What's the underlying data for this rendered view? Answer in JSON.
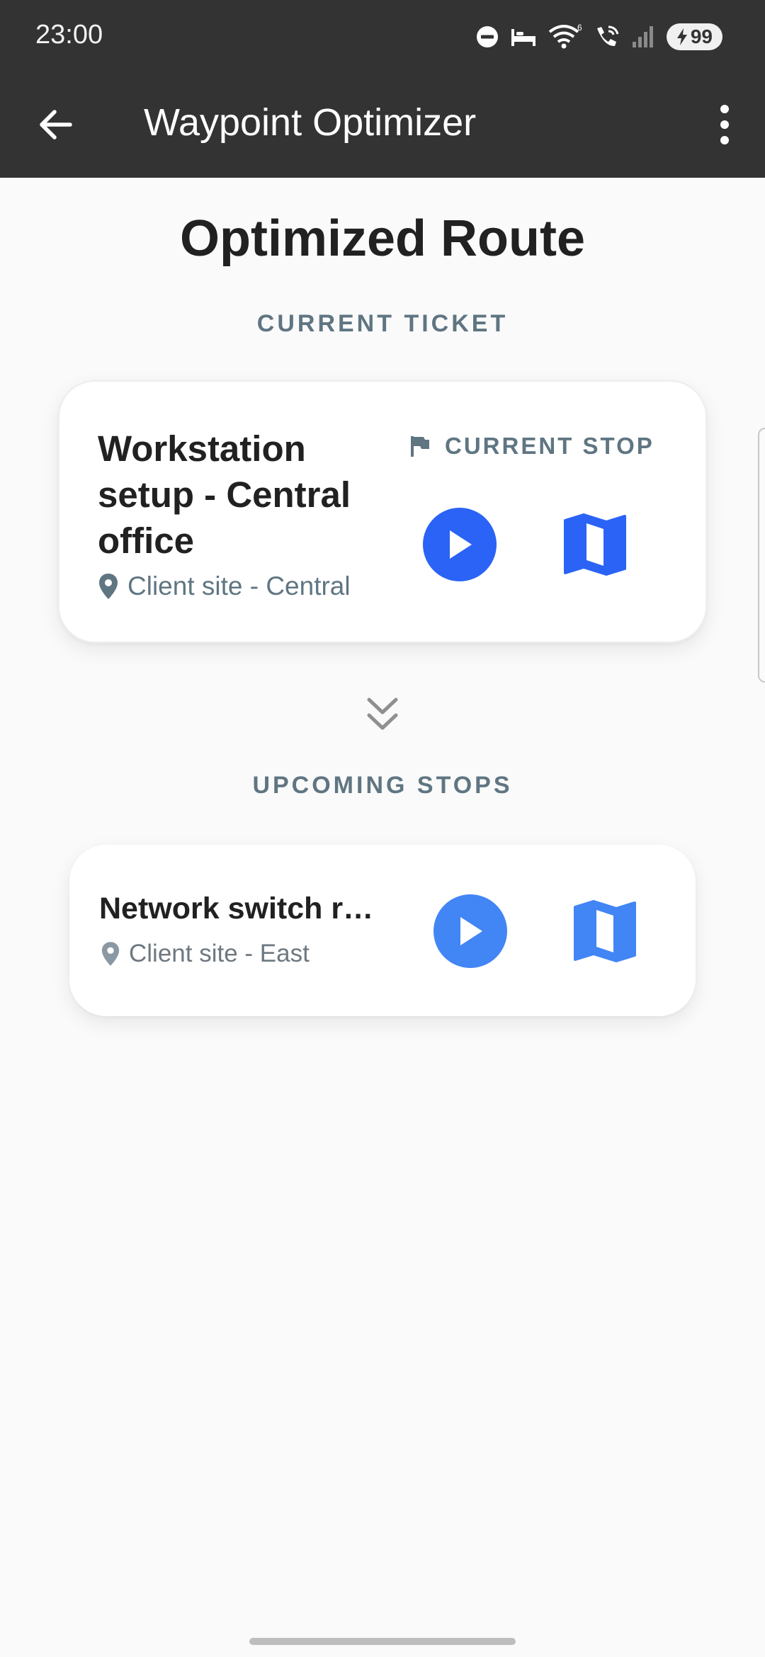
{
  "status_bar": {
    "time": "23:00",
    "battery": "99",
    "icons": [
      "do-not-disturb-icon",
      "sleep-icon",
      "wifi-icon",
      "wifi-calling-icon",
      "signal-icon",
      "battery-charging-icon"
    ]
  },
  "app_bar": {
    "title": "Waypoint Optimizer",
    "back_icon": "arrow-back-icon",
    "menu_icon": "more-vert-icon"
  },
  "page": {
    "title": "Optimized Route",
    "current_section_label": "CURRENT TICKET",
    "upcoming_section_label": "UPCOMING STOPS"
  },
  "current_ticket": {
    "title": "Workstation setup - Central office",
    "location": "Client site - Central",
    "badge": "CURRENT STOP",
    "badge_icon": "flag-icon",
    "play_icon": "play-icon",
    "map_icon": "map-icon"
  },
  "upcoming_stops": [
    {
      "title": "Network switch re…",
      "location": "Client site - East",
      "play_icon": "play-icon",
      "map_icon": "map-icon"
    }
  ],
  "colors": {
    "app_bar": "#333333",
    "background": "#fafafa",
    "accent_primary": "#2a63f5",
    "accent_secondary": "#4285f4",
    "muted_text": "#5f7582"
  }
}
